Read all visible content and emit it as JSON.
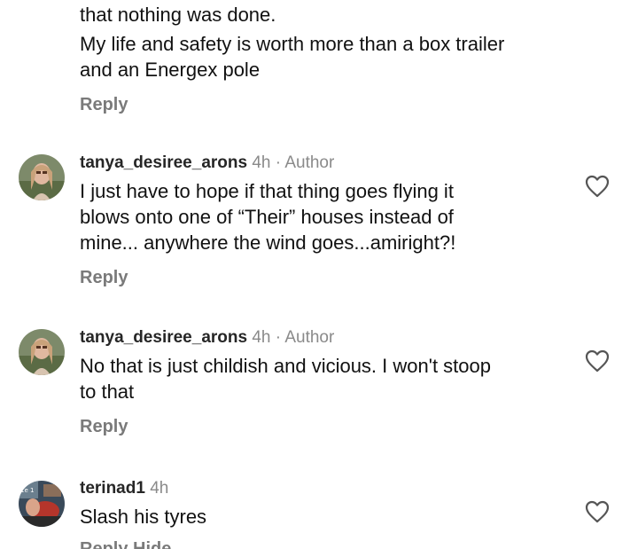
{
  "continued_comment": {
    "lines": [
      "that nothing was done.",
      "My life and safety is worth more than a box trailer",
      "and an Energex pole"
    ],
    "reply_label": "Reply"
  },
  "comments": [
    {
      "username": "tanya_desiree_arons",
      "time": "4h",
      "separator": "·",
      "badge": "Author",
      "lines": [
        "I just have to hope if that thing goes flying it",
        "blows onto one of “Their” houses instead of",
        "mine... anywhere the wind goes...amiright?!"
      ],
      "reply_label": "Reply",
      "icon": "heart-outline"
    },
    {
      "username": "tanya_desiree_arons",
      "time": "4h",
      "separator": "·",
      "badge": "Author",
      "lines": [
        "No that is just childish and vicious. I won't stoop",
        "to that"
      ],
      "reply_label": "Reply",
      "icon": "heart-outline"
    },
    {
      "username": "terinad1",
      "time": "4h",
      "lines": [
        "Slash his tyres"
      ],
      "actions_partial": "Reply    Hide",
      "icon": "heart-outline"
    }
  ],
  "colors": {
    "text": "#111111",
    "muted": "#8a8a8a",
    "reply": "#7a7a7a",
    "background": "#ffffff"
  }
}
